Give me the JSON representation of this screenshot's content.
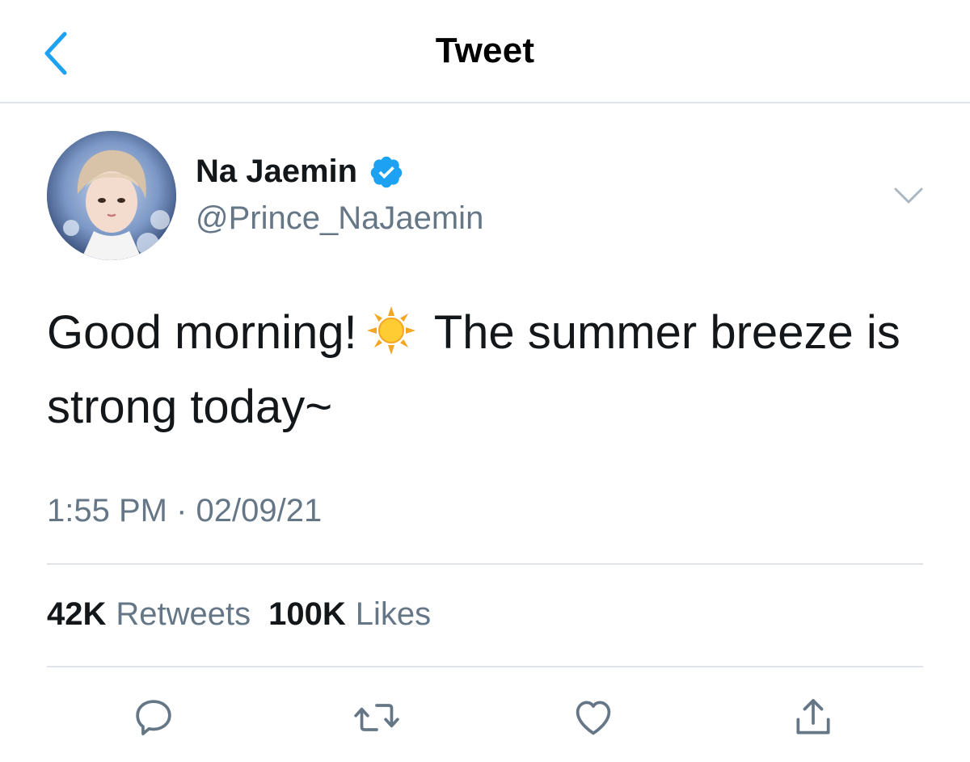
{
  "header": {
    "title": "Tweet",
    "back_icon": "chevron-left-icon"
  },
  "author": {
    "display_name": "Na Jaemin",
    "handle": "@Prince_NaJaemin",
    "verified": true
  },
  "tweet": {
    "text_part1": "Good morning!",
    "emoji": "sun-emoji",
    "text_part2": "The summer breeze is strong today~",
    "timestamp": "1:55 PM · 02/09/21"
  },
  "stats": {
    "retweets_count": "42K",
    "retweets_label": "Retweets",
    "likes_count": "100K",
    "likes_label": "Likes"
  },
  "actions": [
    "reply-icon",
    "retweet-icon",
    "like-icon",
    "share-icon"
  ],
  "colors": {
    "accent": "#1DA1F2",
    "text": "#14171A",
    "secondary": "#657786",
    "icon": "#657786",
    "divider": "#E1E4E8"
  }
}
